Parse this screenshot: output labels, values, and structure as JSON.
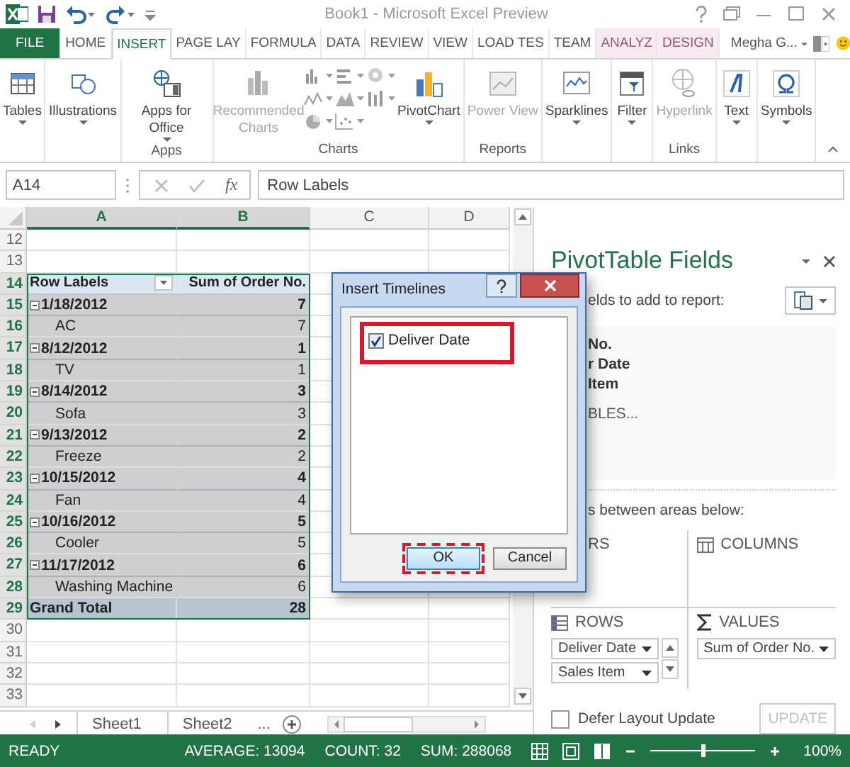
{
  "window": {
    "title": "Book1 - Microsoft Excel Preview"
  },
  "tabs": [
    {
      "label": "FILE",
      "kind": "file",
      "selected": false
    },
    {
      "label": "HOME",
      "kind": "plain",
      "selected": false
    },
    {
      "label": "INSERT",
      "kind": "plain",
      "selected": true
    },
    {
      "label": "PAGE LAY",
      "kind": "plain",
      "selected": false
    },
    {
      "label": "FORMULA",
      "kind": "plain",
      "selected": false
    },
    {
      "label": "DATA",
      "kind": "plain",
      "selected": false
    },
    {
      "label": "REVIEW",
      "kind": "plain",
      "selected": false
    },
    {
      "label": "VIEW",
      "kind": "plain",
      "selected": false
    },
    {
      "label": "LOAD TES",
      "kind": "plain",
      "selected": false
    },
    {
      "label": "TEAM",
      "kind": "plain",
      "selected": false
    },
    {
      "label": "ANALYZ",
      "kind": "contextual",
      "selected": false
    },
    {
      "label": "DESIGN",
      "kind": "contextual",
      "selected": false
    }
  ],
  "user": {
    "name": "Megha G..."
  },
  "ribbon": [
    {
      "items": [
        {
          "kind": "button",
          "label": "Tables",
          "dropdown": true,
          "disabled": false
        }
      ]
    },
    {
      "items": [
        {
          "kind": "button",
          "label": "Illustrations",
          "dropdown": true,
          "disabled": false
        }
      ]
    },
    {
      "label": "Apps",
      "items": [
        {
          "kind": "button",
          "label": "Apps for Office",
          "dropdown": true,
          "disabled": false
        }
      ]
    },
    {
      "label": "Charts",
      "items": [
        {
          "kind": "button",
          "label": "Recommended Charts",
          "dropdown": false,
          "disabled": true
        },
        {
          "kind": "gallery"
        },
        {
          "kind": "button",
          "label": "PivotChart",
          "dropdown": true,
          "disabled": false
        }
      ]
    },
    {
      "label": "Reports",
      "items": [
        {
          "kind": "button",
          "label": "Power View",
          "dropdown": false,
          "disabled": true
        }
      ]
    },
    {
      "items": [
        {
          "kind": "button",
          "label": "Sparklines",
          "dropdown": true,
          "disabled": false
        }
      ]
    },
    {
      "items": [
        {
          "kind": "button",
          "label": "Filter",
          "dropdown": true,
          "disabled": false
        }
      ]
    },
    {
      "label": "Links",
      "items": [
        {
          "kind": "button",
          "label": "Hyperlink",
          "dropdown": false,
          "disabled": true
        }
      ]
    },
    {
      "items": [
        {
          "kind": "button",
          "label": "Text",
          "dropdown": true,
          "disabled": false
        }
      ]
    },
    {
      "items": [
        {
          "kind": "button",
          "label": "Symbols",
          "dropdown": true,
          "disabled": false
        }
      ]
    }
  ],
  "formula_bar": {
    "name_box": "A14",
    "function_label": "fx",
    "value": "Row Labels"
  },
  "sheet": {
    "columns": [
      {
        "label": "A",
        "selected": true
      },
      {
        "label": "B",
        "selected": true
      },
      {
        "label": "C",
        "selected": false
      },
      {
        "label": "D",
        "selected": false
      }
    ],
    "rows": [
      {
        "num": "12",
        "kind": "empty",
        "selected": false
      },
      {
        "num": "13",
        "kind": "empty",
        "selected": false
      },
      {
        "num": "14",
        "kind": "header",
        "selected": true,
        "cells": [
          "Row Labels",
          "Sum of Order No."
        ]
      },
      {
        "num": "15",
        "kind": "date",
        "expanded": true,
        "selected": true,
        "cells": [
          "1/18/2012",
          "7"
        ]
      },
      {
        "num": "16",
        "kind": "item",
        "selected": true,
        "cells": [
          "AC",
          "7"
        ]
      },
      {
        "num": "17",
        "kind": "date",
        "expanded": true,
        "selected": true,
        "cells": [
          "8/12/2012",
          "1"
        ]
      },
      {
        "num": "18",
        "kind": "item",
        "selected": true,
        "cells": [
          "TV",
          "1"
        ]
      },
      {
        "num": "19",
        "kind": "date",
        "expanded": true,
        "selected": true,
        "cells": [
          "8/14/2012",
          "3"
        ]
      },
      {
        "num": "20",
        "kind": "item",
        "selected": true,
        "cells": [
          "Sofa",
          "3"
        ]
      },
      {
        "num": "21",
        "kind": "date",
        "expanded": true,
        "selected": true,
        "cells": [
          "9/13/2012",
          "2"
        ]
      },
      {
        "num": "22",
        "kind": "item",
        "selected": true,
        "cells": [
          "Freeze",
          "2"
        ]
      },
      {
        "num": "23",
        "kind": "date",
        "expanded": true,
        "selected": true,
        "cells": [
          "10/15/2012",
          "4"
        ]
      },
      {
        "num": "24",
        "kind": "item",
        "selected": true,
        "cells": [
          "Fan",
          "4"
        ]
      },
      {
        "num": "25",
        "kind": "date",
        "expanded": true,
        "selected": true,
        "cells": [
          "10/16/2012",
          "5"
        ]
      },
      {
        "num": "26",
        "kind": "item",
        "selected": true,
        "cells": [
          "Cooler",
          "5"
        ]
      },
      {
        "num": "27",
        "kind": "date",
        "expanded": true,
        "selected": true,
        "cells": [
          "11/17/2012",
          "6"
        ]
      },
      {
        "num": "28",
        "kind": "item",
        "selected": true,
        "cells": [
          "Washing Machine",
          "6"
        ]
      },
      {
        "num": "29",
        "kind": "total",
        "selected": true,
        "cells": [
          "Grand Total",
          "28"
        ]
      },
      {
        "num": "30",
        "kind": "empty",
        "selected": false
      },
      {
        "num": "31",
        "kind": "empty",
        "selected": false
      },
      {
        "num": "32",
        "kind": "empty",
        "selected": false
      },
      {
        "num": "33",
        "kind": "empty",
        "selected": false
      }
    ]
  },
  "sheet_tabs": [
    {
      "label": "Sheet1",
      "selected": false
    },
    {
      "label": "Sheet2",
      "selected": false
    }
  ],
  "more_sheets": "...",
  "status_bar": {
    "mode": "READY",
    "stats": [
      "AVERAGE: 13094",
      "COUNT: 32",
      "SUM: 288068"
    ],
    "zoom": {
      "level": 0.5,
      "reading": "100%"
    }
  },
  "pivot_panel": {
    "title": "PivotTable Fields",
    "hint": "elds to add to report:",
    "fields": [
      "No.",
      "r Date",
      "Item"
    ],
    "more_tables": "BLES...",
    "drag_hint": "s between areas below:",
    "areas": [
      {
        "kind": "filters",
        "label": "RS"
      },
      {
        "kind": "columns",
        "label": "COLUMNS"
      },
      {
        "kind": "rows",
        "label": "ROWS",
        "items": [
          "Deliver Date",
          "Sales Item"
        ]
      },
      {
        "kind": "values",
        "label": "VALUES",
        "items": [
          "Sum of Order No."
        ]
      }
    ],
    "defer": {
      "label": "Defer Layout Update",
      "checked": false
    },
    "update_button": {
      "label": "UPDATE",
      "disabled": true
    }
  },
  "dialog": {
    "title": "Insert Timelines",
    "options": [
      {
        "label": "Deliver Date",
        "checked": true,
        "highlighted": true
      }
    ],
    "buttons": [
      {
        "label": "OK",
        "highlighted": true
      },
      {
        "label": "Cancel",
        "highlighted": false
      }
    ]
  }
}
